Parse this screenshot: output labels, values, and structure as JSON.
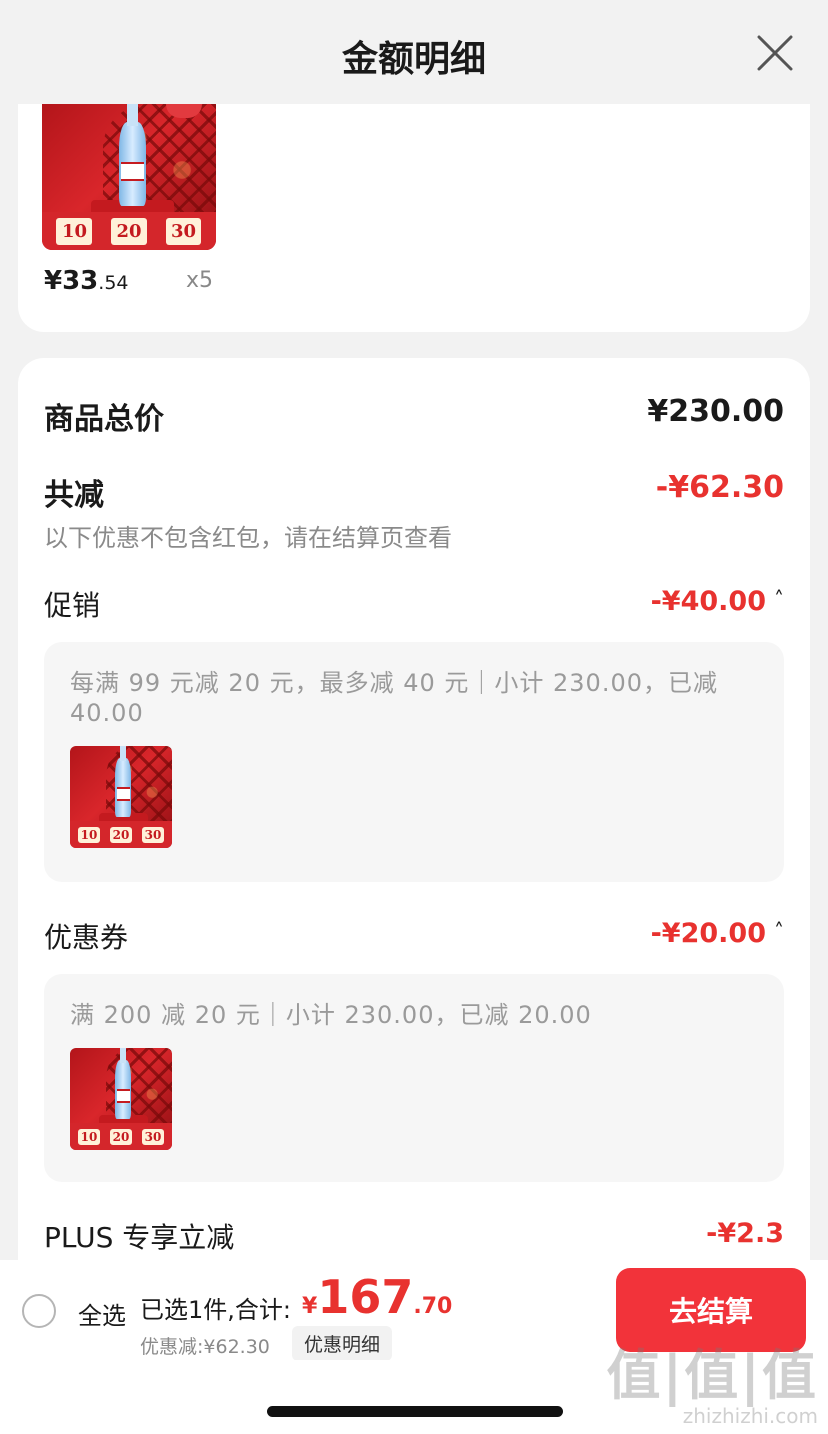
{
  "header": {
    "title": "金额明细"
  },
  "top_item": {
    "price_symbol": "¥",
    "price_int": "33",
    "price_dec": ".54",
    "quantity": "x5",
    "thumb_coupons": [
      "10",
      "20",
      "30"
    ]
  },
  "summary": {
    "total_label": "商品总价",
    "total_value": "¥230.00",
    "reduce_label": "共减",
    "reduce_value": "-¥62.30",
    "note": "以下优惠不包含红包，请在结算页查看"
  },
  "promotion": {
    "label": "促销",
    "value": "-¥40.00",
    "caret": "˄",
    "detail": "每满 99 元减 20 元，最多减 40 元｜小计 230.00，已减 40.00"
  },
  "coupon": {
    "label": "优惠券",
    "value": "-¥20.00",
    "caret": "˄",
    "detail": "满 200 减 20 元｜小计 230.00，已减 20.00"
  },
  "plus": {
    "label": "PLUS 专享立减",
    "value": "-¥2.3"
  },
  "bottom_bar": {
    "select_all": "全选",
    "selected_text": "已选1件,合计:",
    "total_symbol": "¥",
    "total_int": "167",
    "total_dec": ".70",
    "discount_text": "优惠减:¥62.30",
    "detail_chip": "优惠明细",
    "checkout": "去结算"
  },
  "watermark": {
    "logo": "值|值|值",
    "site": "zhizhizhi.com"
  },
  "colors": {
    "accent_red": "#e8322f",
    "button_red": "#f2333a"
  }
}
